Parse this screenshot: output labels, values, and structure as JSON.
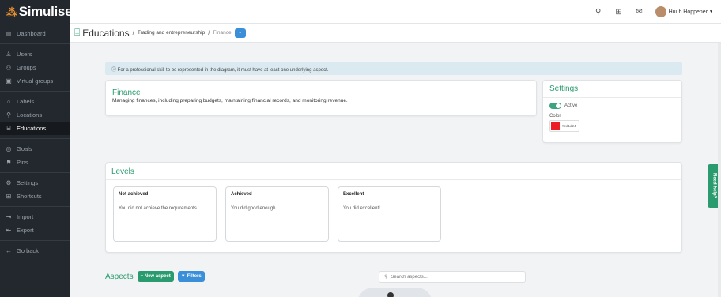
{
  "app": {
    "logo": "Simulise"
  },
  "sidebar": {
    "groups": [
      [
        {
          "icon": "dashboard-icon",
          "glyph": "◍",
          "label": "Dashboard"
        }
      ],
      [
        {
          "icon": "user-icon",
          "glyph": "♙",
          "label": "Users"
        },
        {
          "icon": "groups-icon",
          "glyph": "⚇",
          "label": "Groups"
        },
        {
          "icon": "virtual-groups-icon",
          "glyph": "▣",
          "label": "Virtual groups"
        }
      ],
      [
        {
          "icon": "label-icon",
          "glyph": "⌂",
          "label": "Labels"
        },
        {
          "icon": "location-icon",
          "glyph": "⚲",
          "label": "Locations"
        },
        {
          "icon": "education-icon",
          "glyph": "⌸",
          "label": "Educations",
          "active": true
        }
      ],
      [
        {
          "icon": "goals-icon",
          "glyph": "◎",
          "label": "Goals"
        },
        {
          "icon": "pin-icon",
          "glyph": "⚑",
          "label": "Pins"
        }
      ],
      [
        {
          "icon": "settings-icon",
          "glyph": "⚙",
          "label": "Settings"
        },
        {
          "icon": "shortcuts-icon",
          "glyph": "⊞",
          "label": "Shortcuts"
        }
      ],
      [
        {
          "icon": "import-icon",
          "glyph": "⇥",
          "label": "Import"
        },
        {
          "icon": "export-icon",
          "glyph": "⇤",
          "label": "Export"
        }
      ],
      [
        {
          "icon": "go-back-icon",
          "glyph": "←",
          "label": "Go back"
        }
      ]
    ]
  },
  "topbar": {
    "user_name": "Huub Hoppener"
  },
  "breadcrumb": {
    "title": "Educations",
    "items": [
      "Trading and entrepreneurship",
      "Finance"
    ]
  },
  "info_text": "ⓘ For a professional skill to be represented in the diagram, it must have at least one underlying aspect.",
  "finance": {
    "title": "Finance",
    "description": "Managing finances, including preparing budgets, maintaining financial records, and monitoring revenue."
  },
  "settings": {
    "title": "Settings",
    "active_label": "Active",
    "color_label": "Color",
    "color_hex": "#ed1d24"
  },
  "levels": {
    "title": "Levels",
    "items": [
      {
        "name": "Not achieved",
        "description": "You did not achieve the requirements"
      },
      {
        "name": "Achieved",
        "description": "You did good enough"
      },
      {
        "name": "Excellent",
        "description": "You did excellent!"
      }
    ]
  },
  "aspects": {
    "title": "Aspects",
    "new_label": "+ New aspect",
    "filters_label": "Filters",
    "search_placeholder": "Search aspects..."
  },
  "help_label": "Need help?",
  "colors": {
    "accent": "#2a9b6f",
    "sidebar": "#22282e",
    "info_bg": "#dbeaf1",
    "blue": "#3a8fd8"
  }
}
